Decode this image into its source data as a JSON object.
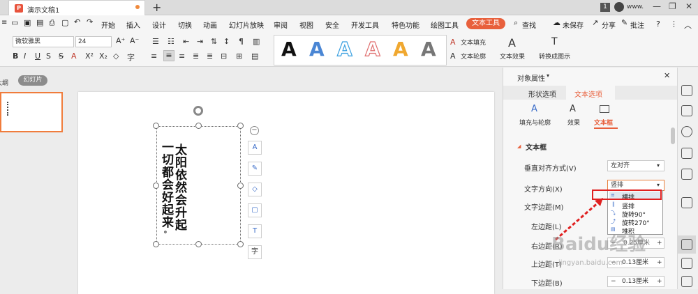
{
  "titlebar": {
    "doc_title": "演示文稿1",
    "new_tab": "+",
    "page_badge": "1",
    "username": "www."
  },
  "menu": {
    "items": [
      "开始",
      "插入",
      "设计",
      "切换",
      "动画",
      "幻灯片放映",
      "审阅",
      "视图",
      "安全",
      "开发工具",
      "特色功能",
      "绘图工具",
      "文本工具",
      "查找",
      "未保存",
      "分享",
      "批注"
    ],
    "help": "?"
  },
  "ribbon": {
    "font_name": "微软雅黑",
    "font_size": "24",
    "text_fill": "文本填充",
    "text_outline": "文本轮廓",
    "text_effect": "文本效果",
    "convert_smartart": "转换成图示",
    "style_glyph": "A"
  },
  "leftpane": {
    "tab_outline": "大纲",
    "tab_slides": "幻灯片",
    "slide_number": "1"
  },
  "slide": {
    "col1": "太阳依然会升起",
    "col2": "一切都会好起来",
    "col2_end": "。"
  },
  "panel": {
    "title": "对象属性",
    "tab_shape": "形状选项",
    "tab_text": "文本选项",
    "sub_fill": "填充与轮廓",
    "sub_effect": "效果",
    "sub_textbox": "文本框",
    "section": "文本框",
    "valign_label": "垂直对齐方式(V)",
    "valign_value": "左对齐",
    "dir_label": "文字方向(X)",
    "dir_value": "竖排",
    "margin_label": "文字边距(M)",
    "left_label": "左边距(L)",
    "right_label": "右边距(R)",
    "top_label": "上边距(T)",
    "top_value": "0.13厘米",
    "bottom_label": "下边距(B)",
    "bottom_value": "0.13厘米",
    "right_value": "0.25厘米",
    "dropdown": [
      "横排",
      "竖排",
      "旋转90°",
      "旋转270°",
      "堆积"
    ]
  },
  "watermark": {
    "main": "Baidu经验",
    "sub": "jingyan.baidu.com"
  },
  "colors": {
    "accent": "#e8603c",
    "highlight_border": "#e02020",
    "selected_tab": "#e8603c"
  }
}
